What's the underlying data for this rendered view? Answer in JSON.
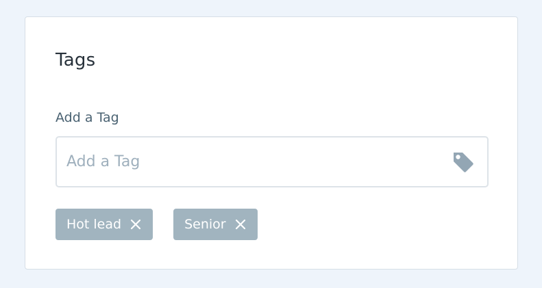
{
  "card": {
    "title": "Tags"
  },
  "tag_input": {
    "label": "Add a Tag",
    "placeholder": "Add a Tag",
    "value": "",
    "icon": "tag-icon"
  },
  "tags": [
    {
      "label": "Hot lead",
      "remove_icon": "close-icon"
    },
    {
      "label": "Senior",
      "remove_icon": "close-icon"
    }
  ],
  "colors": {
    "background": "#eef4fb",
    "card": "#ffffff",
    "chip": "#a1b4bf",
    "icon": "#93a6b4",
    "label": "#4a6272",
    "title": "#27313a"
  }
}
